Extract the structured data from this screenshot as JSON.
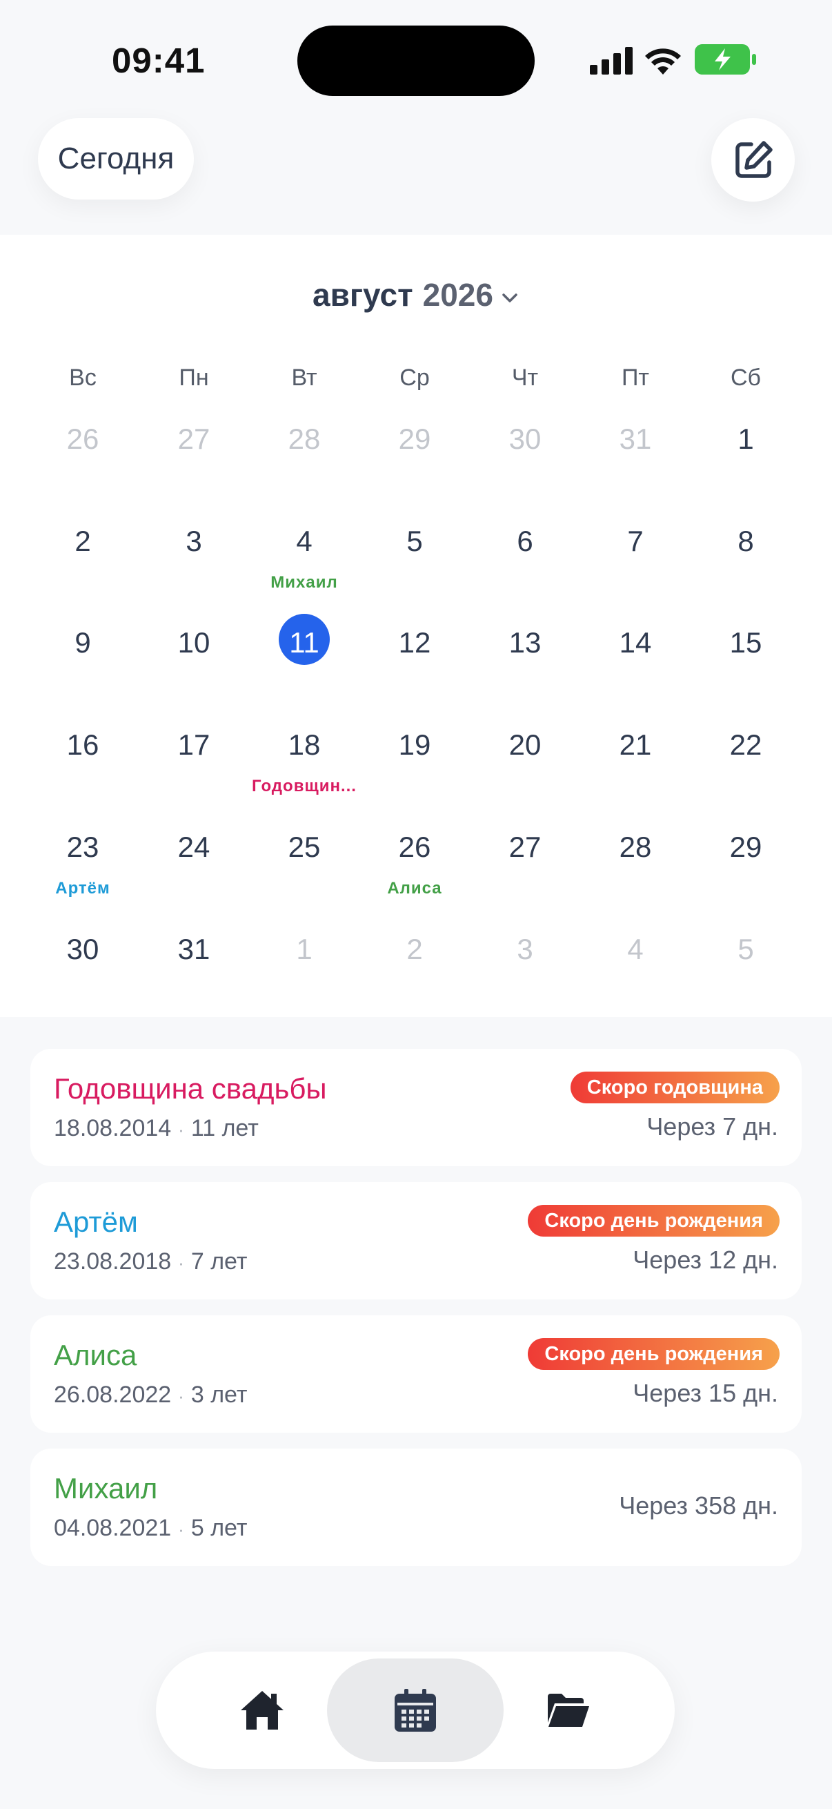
{
  "status_bar": {
    "time": "09:41"
  },
  "header": {
    "today_label": "Сегодня"
  },
  "calendar": {
    "month": "август",
    "year": "2026",
    "weekdays": [
      "Вс",
      "Пн",
      "Вт",
      "Ср",
      "Чт",
      "Пт",
      "Сб"
    ],
    "weeks": [
      [
        {
          "d": "26",
          "muted": true
        },
        {
          "d": "27",
          "muted": true
        },
        {
          "d": "28",
          "muted": true
        },
        {
          "d": "29",
          "muted": true
        },
        {
          "d": "30",
          "muted": true
        },
        {
          "d": "31",
          "muted": true
        },
        {
          "d": "1"
        }
      ],
      [
        {
          "d": "2"
        },
        {
          "d": "3"
        },
        {
          "d": "4",
          "event": "Михаил",
          "color": "#43a047"
        },
        {
          "d": "5"
        },
        {
          "d": "6"
        },
        {
          "d": "7"
        },
        {
          "d": "8"
        }
      ],
      [
        {
          "d": "9"
        },
        {
          "d": "10"
        },
        {
          "d": "11",
          "selected": true
        },
        {
          "d": "12"
        },
        {
          "d": "13"
        },
        {
          "d": "14"
        },
        {
          "d": "15"
        }
      ],
      [
        {
          "d": "16"
        },
        {
          "d": "17"
        },
        {
          "d": "18",
          "event": "Годовщин...",
          "color": "#d81b60"
        },
        {
          "d": "19"
        },
        {
          "d": "20"
        },
        {
          "d": "21"
        },
        {
          "d": "22"
        }
      ],
      [
        {
          "d": "23",
          "event": "Артём",
          "color": "#1e9bd7"
        },
        {
          "d": "24"
        },
        {
          "d": "25"
        },
        {
          "d": "26",
          "event": "Алиса",
          "color": "#43a047"
        },
        {
          "d": "27"
        },
        {
          "d": "28"
        },
        {
          "d": "29"
        }
      ],
      [
        {
          "d": "30"
        },
        {
          "d": "31"
        },
        {
          "d": "1",
          "muted": true
        },
        {
          "d": "2",
          "muted": true
        },
        {
          "d": "3",
          "muted": true
        },
        {
          "d": "4",
          "muted": true
        },
        {
          "d": "5",
          "muted": true
        }
      ]
    ]
  },
  "events": [
    {
      "name": "Годовщина свадьбы",
      "color": "#d81b60",
      "date": "18.08.2014",
      "age": "11 лет",
      "badge": "Скоро годовщина",
      "countdown": "Через 7 дн."
    },
    {
      "name": "Артём",
      "color": "#1e9bd7",
      "date": "23.08.2018",
      "age": "7 лет",
      "badge": "Скоро день рождения",
      "countdown": "Через 12 дн."
    },
    {
      "name": "Алиса",
      "color": "#43a047",
      "date": "26.08.2022",
      "age": "3 лет",
      "badge": "Скоро день рождения",
      "countdown": "Через 15 дн."
    },
    {
      "name": "Михаил",
      "color": "#43a047",
      "date": "04.08.2021",
      "age": "5 лет",
      "badge": "",
      "countdown": "Через 358 дн."
    }
  ],
  "separator": "·",
  "tab_bar": {
    "tabs": [
      {
        "icon": "home-icon",
        "active": false
      },
      {
        "icon": "calendar-icon",
        "active": true
      },
      {
        "icon": "folder-icon",
        "active": false
      }
    ]
  }
}
